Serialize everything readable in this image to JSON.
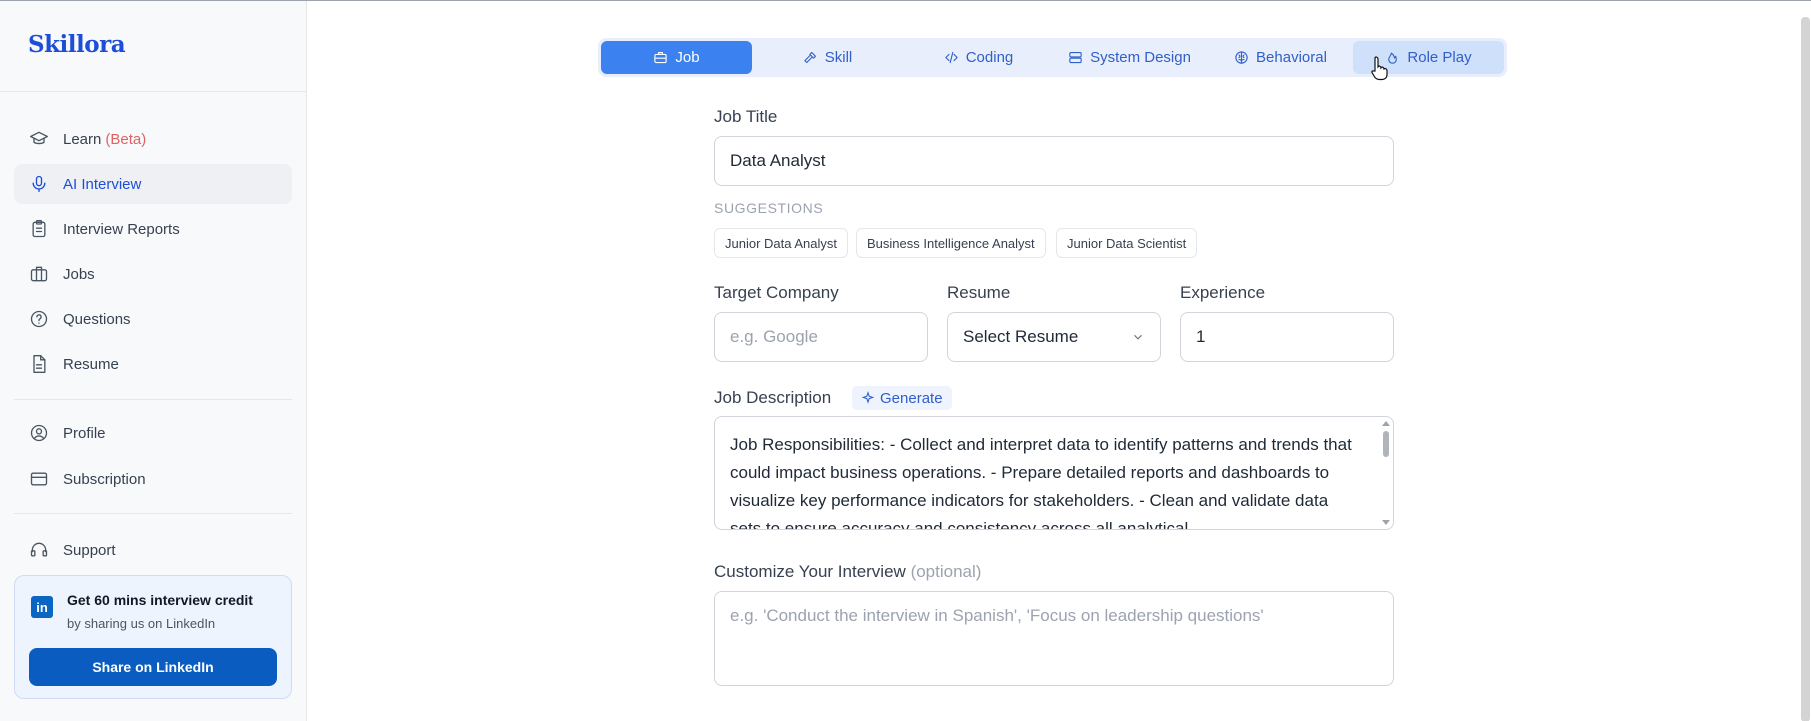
{
  "app": {
    "logo": "Skillora"
  },
  "sidebar": {
    "items": [
      {
        "label": "Learn",
        "badge": "(Beta)",
        "icon": "graduation-cap-icon"
      },
      {
        "label": "AI Interview",
        "icon": "microphone-icon",
        "active": true
      },
      {
        "label": "Interview Reports",
        "icon": "clipboard-icon"
      },
      {
        "label": "Jobs",
        "icon": "briefcase-icon"
      },
      {
        "label": "Questions",
        "icon": "question-circle-icon"
      },
      {
        "label": "Resume",
        "icon": "document-icon"
      },
      {
        "label": "Profile",
        "icon": "user-circle-icon"
      },
      {
        "label": "Subscription",
        "icon": "credit-card-icon"
      },
      {
        "label": "Support",
        "icon": "headset-icon"
      }
    ],
    "promo": {
      "title": "Get 60 mins interview credit",
      "subtitle": "by sharing us on LinkedIn",
      "button": "Share on LinkedIn",
      "icon_text": "in"
    }
  },
  "tabs": [
    {
      "label": "Job",
      "icon": "briefcase-icon",
      "active": true
    },
    {
      "label": "Skill",
      "icon": "hammer-icon"
    },
    {
      "label": "Coding",
      "icon": "code-icon"
    },
    {
      "label": "System Design",
      "icon": "server-icon"
    },
    {
      "label": "Behavioral",
      "icon": "brain-icon"
    },
    {
      "label": "Role Play",
      "icon": "flame-icon",
      "hovered": true
    }
  ],
  "form": {
    "job_title": {
      "label": "Job Title",
      "value": "Data Analyst"
    },
    "suggestions": {
      "title": "SUGGESTIONS",
      "items": [
        "Junior Data Analyst",
        "Business Intelligence Analyst",
        "Junior Data Scientist"
      ]
    },
    "target_company": {
      "label": "Target Company",
      "placeholder": "e.g. Google"
    },
    "resume": {
      "label": "Resume",
      "value": "Select Resume"
    },
    "experience": {
      "label": "Experience",
      "value": "1"
    },
    "job_description": {
      "label": "Job Description",
      "generate": "Generate",
      "value": "Job Responsibilities: - Collect and interpret data to identify patterns and trends that could impact business operations. - Prepare detailed reports and dashboards to visualize key performance indicators for stakeholders. - Clean and validate data sets to ensure accuracy and consistency across all analytical"
    },
    "customize": {
      "label": "Customize Your Interview",
      "optional": "(optional)",
      "placeholder": "e.g. 'Conduct the interview in Spanish', 'Focus on leadership questions'"
    }
  },
  "colors": {
    "brand": "#1d4ed8",
    "accent": "#3b82f0",
    "linkedin": "#0a5cc0",
    "beta": "#e06262"
  }
}
